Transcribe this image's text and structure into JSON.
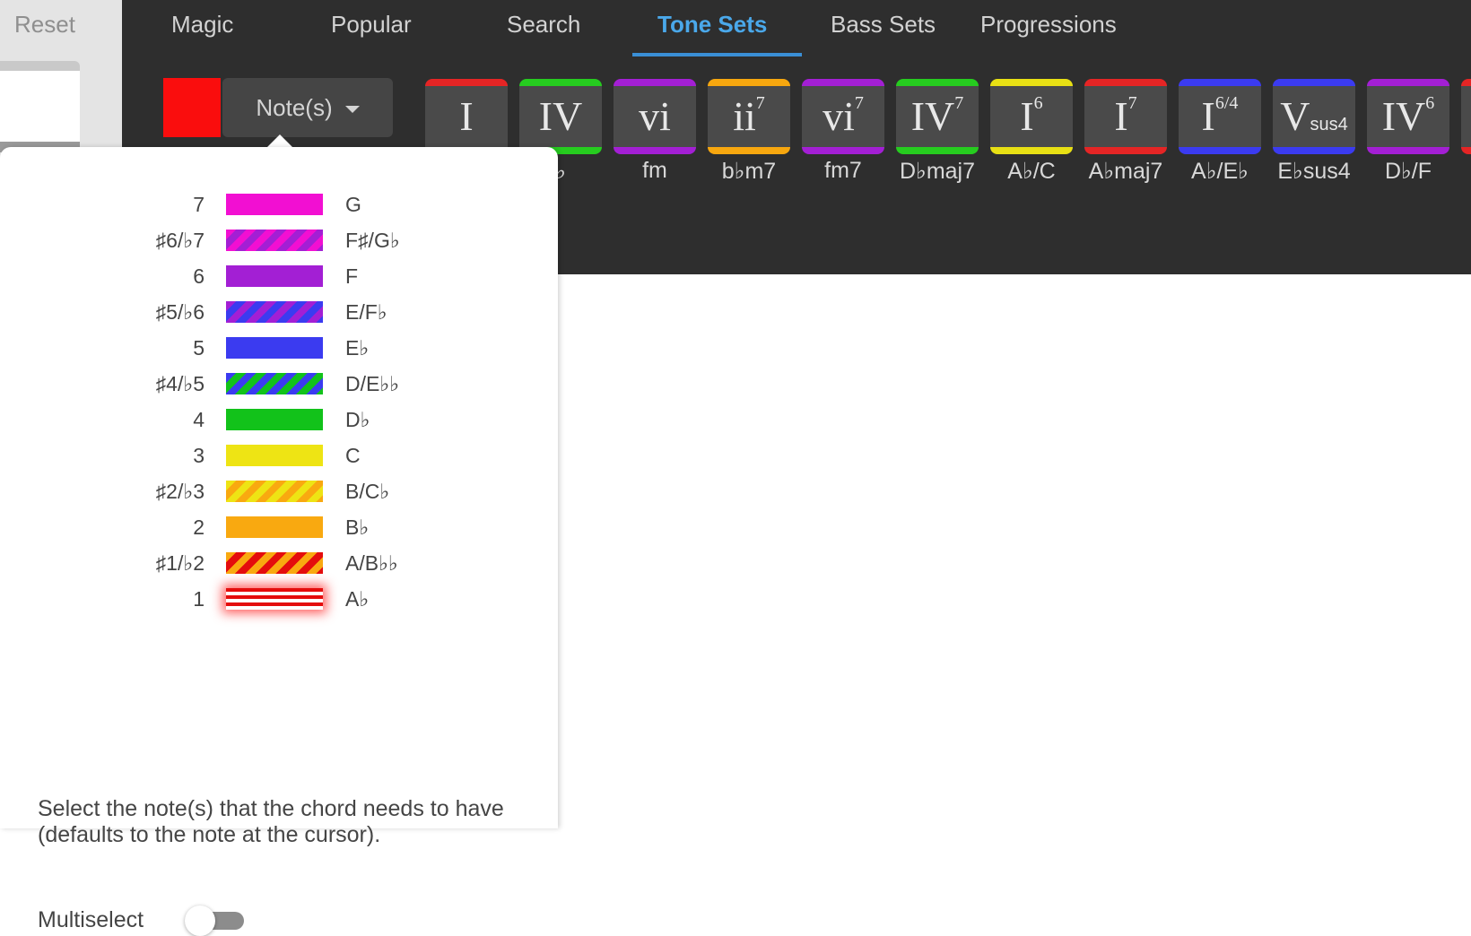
{
  "sidebar": {
    "reset_label": "Reset"
  },
  "tabs": [
    {
      "label": "Magic"
    },
    {
      "label": "Popular"
    },
    {
      "label": "Search"
    },
    {
      "label": "Tone Sets",
      "active": true
    },
    {
      "label": "Bass Sets"
    },
    {
      "label": "Progressions"
    }
  ],
  "toolbar": {
    "selected_color": "#fa0d0d",
    "notes_dropdown_label": "Note(s)"
  },
  "chords": [
    {
      "numeral": "I",
      "sup": "",
      "sub": "",
      "name": "",
      "color": "#e52525"
    },
    {
      "numeral": "IV",
      "sup": "",
      "sub": "",
      "name": "♭",
      "color": "#26cc1f"
    },
    {
      "numeral": "vi",
      "sup": "",
      "sub": "",
      "name": "fm",
      "color": "#a31fd4"
    },
    {
      "numeral": "ii",
      "sup": "7",
      "sub": "",
      "name": "b♭m7",
      "color": "#f7a70f"
    },
    {
      "numeral": "vi",
      "sup": "7",
      "sub": "",
      "name": "fm7",
      "color": "#a31fd4"
    },
    {
      "numeral": "IV",
      "sup": "7",
      "sub": "",
      "name": "D♭maj7",
      "color": "#26cc1f"
    },
    {
      "numeral": "I",
      "sup": "6",
      "sub": "",
      "name": "A♭/C",
      "color": "#e8e014"
    },
    {
      "numeral": "I",
      "sup": "7",
      "sub": "",
      "name": "A♭maj7",
      "color": "#e52525"
    },
    {
      "numeral": "I",
      "sup": "6/4",
      "sub": "",
      "name": "A♭/E♭",
      "color": "#3b3bf0"
    },
    {
      "numeral": "V",
      "sup": "",
      "sub": "sus4",
      "name": "E♭sus4",
      "color": "#3b3bf0"
    },
    {
      "numeral": "IV",
      "sup": "6",
      "sub": "",
      "name": "D♭/F",
      "color": "#a31fd4"
    },
    {
      "numeral": "",
      "sup": "",
      "sub": "",
      "name": "",
      "color": "#e52525"
    }
  ],
  "note_picker": {
    "rows": [
      {
        "degree": "7",
        "note": "G",
        "colors": [
          "#f20fd2"
        ],
        "selected": false
      },
      {
        "degree": "♯6/♭7",
        "note": "F♯/G♭",
        "colors": [
          "#f20fd2",
          "#a31fd4"
        ],
        "selected": false
      },
      {
        "degree": "6",
        "note": "F",
        "colors": [
          "#a31fd4"
        ],
        "selected": false
      },
      {
        "degree": "♯5/♭6",
        "note": "E/F♭",
        "colors": [
          "#a31fd4",
          "#3b3bf0"
        ],
        "selected": false
      },
      {
        "degree": "5",
        "note": "E♭",
        "colors": [
          "#3b3bf0"
        ],
        "selected": false
      },
      {
        "degree": "♯4/♭5",
        "note": "D/E♭♭",
        "colors": [
          "#3b3bf0",
          "#12c21a"
        ],
        "selected": false
      },
      {
        "degree": "4",
        "note": "D♭",
        "colors": [
          "#12c21a"
        ],
        "selected": false
      },
      {
        "degree": "3",
        "note": "C",
        "colors": [
          "#eee414"
        ],
        "selected": false
      },
      {
        "degree": "♯2/♭3",
        "note": "B/C♭",
        "colors": [
          "#eee414",
          "#f9a910"
        ],
        "selected": false
      },
      {
        "degree": "2",
        "note": "B♭",
        "colors": [
          "#f9a910"
        ],
        "selected": false
      },
      {
        "degree": "♯1/♭2",
        "note": "A/B♭♭",
        "colors": [
          "#f9a910",
          "#e40d0d"
        ],
        "selected": false
      },
      {
        "degree": "1",
        "note": "A♭",
        "colors": [
          "#e40d0d"
        ],
        "selected": true
      }
    ],
    "help_text": "Select the note(s) that the chord needs to have (defaults to the note at the cursor).",
    "multiselect_label": "Multiselect",
    "multiselect_on": false
  }
}
